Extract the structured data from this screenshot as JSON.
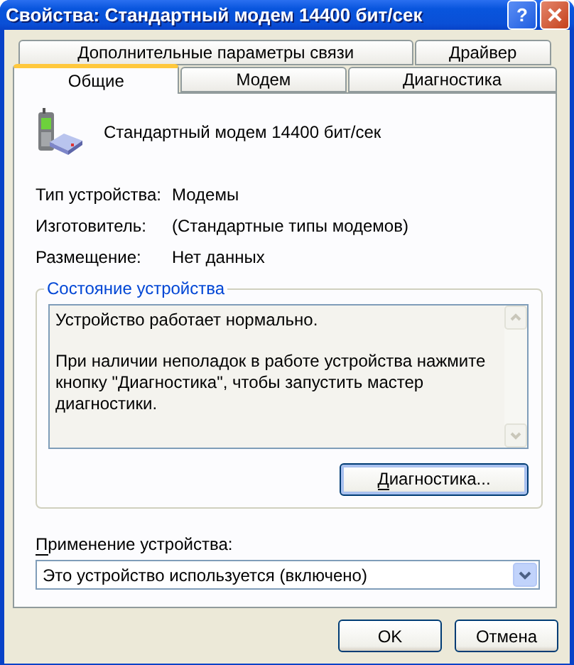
{
  "window": {
    "title": "Свойства: Стандартный модем 14400 бит/сек",
    "help_button": "?"
  },
  "tab_rows": [
    [
      {
        "label": "Дополнительные параметры связи",
        "selected": false
      },
      {
        "label": "Драйвер",
        "selected": false
      }
    ],
    [
      {
        "label": "Общие",
        "selected": true
      },
      {
        "label": "Модем",
        "selected": false
      },
      {
        "label": "Диагностика",
        "selected": false
      }
    ]
  ],
  "device": {
    "name": "Стандартный модем 14400 бит/сек"
  },
  "properties": [
    {
      "label": "Тип устройства:",
      "value": "Модемы"
    },
    {
      "label": "Изготовитель:",
      "value": "(Стандартные типы модемов)"
    },
    {
      "label": "Размещение:",
      "value": "Нет данных"
    }
  ],
  "status": {
    "title": "Состояние устройства",
    "paragraphs": [
      "Устройство работает нормально.",
      "При наличии неполадок в работе устройства нажмите кнопку \"Диагностика\", чтобы запустить мастер диагностики."
    ],
    "button": {
      "label": "Диагностика...",
      "mnemonic_underlined": true
    }
  },
  "usage": {
    "label": "Применение устройства:",
    "mnemonic_underlined": true,
    "value": "Это устройство используется (включено)"
  },
  "buttons": [
    {
      "label": "OK"
    },
    {
      "label": "Отмена"
    }
  ]
}
